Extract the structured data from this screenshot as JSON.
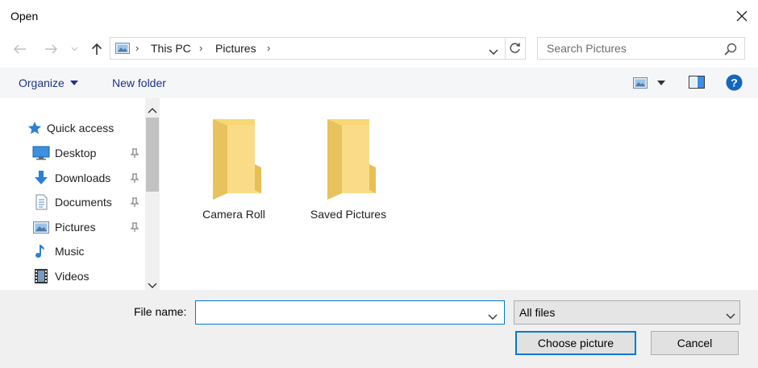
{
  "window": {
    "title": "Open"
  },
  "breadcrumb": {
    "items": [
      "This PC",
      "Pictures"
    ]
  },
  "search": {
    "placeholder": "Search Pictures"
  },
  "commandbar": {
    "organize_label": "Organize",
    "new_folder_label": "New folder"
  },
  "sidebar": {
    "items": [
      {
        "label": "Quick access",
        "icon": "star-icon"
      },
      {
        "label": "Desktop",
        "icon": "desktop-icon"
      },
      {
        "label": "Downloads",
        "icon": "download-arrow-icon"
      },
      {
        "label": "Documents",
        "icon": "documents-icon"
      },
      {
        "label": "Pictures",
        "icon": "pictures-icon"
      },
      {
        "label": "Music",
        "icon": "music-note-icon"
      },
      {
        "label": "Videos",
        "icon": "film-icon"
      }
    ]
  },
  "content": {
    "folders": [
      {
        "label": "Camera Roll"
      },
      {
        "label": "Saved Pictures"
      }
    ]
  },
  "footer": {
    "file_name_label": "File name:",
    "file_name_value": "",
    "file_type_selected": "All files",
    "open_button_label": "Choose picture",
    "cancel_button_label": "Cancel"
  },
  "colors": {
    "accent": "#0078d7",
    "command_text": "#1e3287",
    "folder_yellow": "#f8d775",
    "help_blue": "#1565c0"
  }
}
